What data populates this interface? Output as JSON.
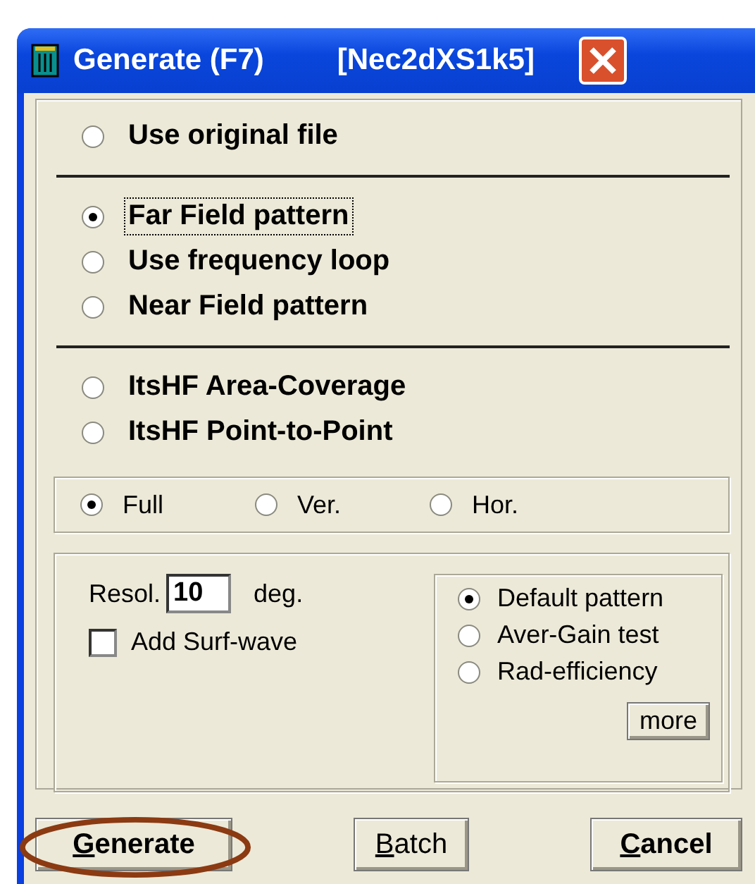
{
  "window": {
    "title": "Generate (F7)",
    "subtitle": "[Nec2dXS1k5]"
  },
  "sections": [
    {
      "options": [
        {
          "label": "Use original file",
          "selected": false,
          "focused": false
        }
      ]
    },
    {
      "options": [
        {
          "label": "Far Field pattern",
          "selected": true,
          "focused": true
        },
        {
          "label": "Use frequency loop",
          "selected": false,
          "focused": false
        },
        {
          "label": "Near Field pattern",
          "selected": false,
          "focused": false
        }
      ]
    },
    {
      "options": [
        {
          "label": "ItsHF Area-Coverage",
          "selected": false,
          "focused": false
        },
        {
          "label": "ItsHF Point-to-Point",
          "selected": false,
          "focused": false
        }
      ]
    }
  ],
  "scope_options": [
    {
      "label": "Full",
      "selected": true
    },
    {
      "label": "Ver.",
      "selected": false
    },
    {
      "label": "Hor.",
      "selected": false
    }
  ],
  "resolution": {
    "label": "Resol.",
    "value": "10",
    "unit": "deg."
  },
  "surf_wave": {
    "label": "Add Surf-wave",
    "checked": false
  },
  "pattern_options": [
    {
      "label": "Default pattern",
      "selected": true
    },
    {
      "label": "Aver-Gain test",
      "selected": false
    },
    {
      "label": "Rad-efficiency",
      "selected": false
    }
  ],
  "more_button": "more",
  "buttons": [
    {
      "label": "Generate",
      "emphasized": true,
      "mnemonic": true,
      "highlighted": true
    },
    {
      "label": "Batch",
      "emphasized": false,
      "mnemonic": true,
      "highlighted": false
    },
    {
      "label": "Cancel",
      "emphasized": true,
      "mnemonic": true,
      "highlighted": false
    }
  ]
}
